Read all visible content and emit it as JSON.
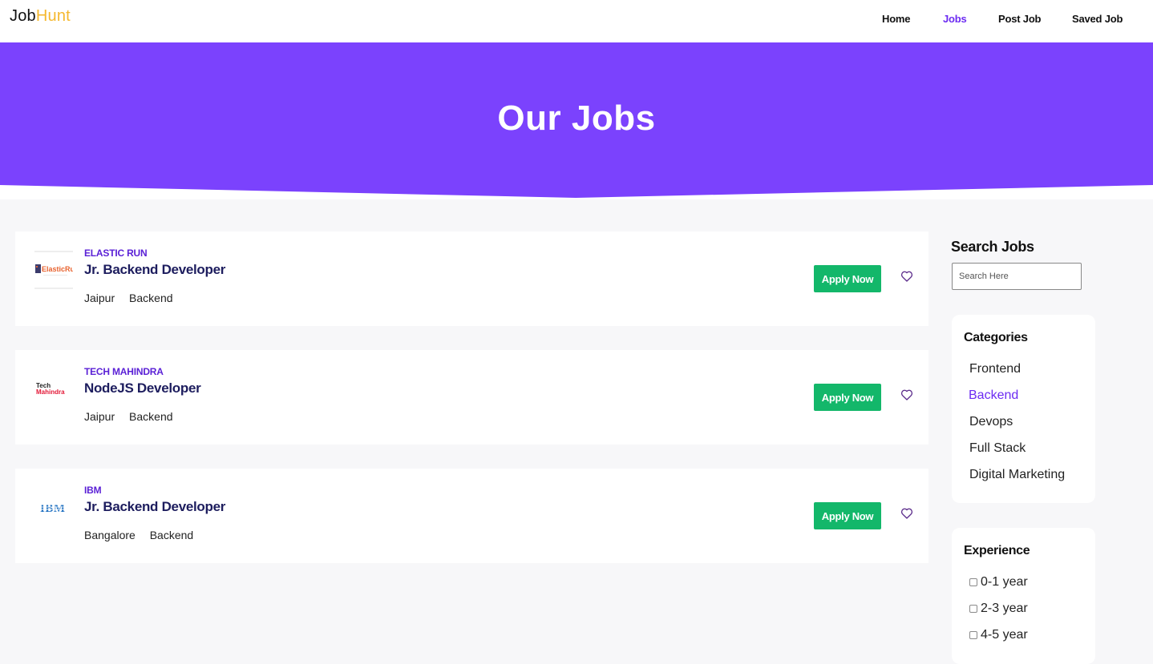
{
  "brand": {
    "logo_part1": "Job",
    "logo_part2": "Hunt"
  },
  "nav": {
    "items": [
      {
        "label": "Home",
        "active": false
      },
      {
        "label": "Jobs",
        "active": true
      },
      {
        "label": "Post Job",
        "active": false
      },
      {
        "label": "Saved Job",
        "active": false
      }
    ]
  },
  "hero": {
    "title": "Our Jobs"
  },
  "jobs": [
    {
      "company": "ELASTIC RUN",
      "title": "Jr. Backend Developer",
      "location": "Jaipur",
      "category": "Backend",
      "apply_label": "Apply Now",
      "logo_text": "ElasticRun"
    },
    {
      "company": "TECH MAHINDRA",
      "title": "NodeJS Developer",
      "location": "Jaipur",
      "category": "Backend",
      "apply_label": "Apply Now",
      "logo_text_1": "Tech",
      "logo_text_2": "Mahindra"
    },
    {
      "company": "IBM",
      "title": "Jr. Backend Developer",
      "location": "Bangalore",
      "category": "Backend",
      "apply_label": "Apply Now",
      "logo_text": "IBM"
    }
  ],
  "sidebar": {
    "search_title": "Search Jobs",
    "search_placeholder": "Search Here",
    "categories_title": "Categories",
    "categories": [
      "Frontend",
      "Backend",
      "Devops",
      "Full Stack",
      "Digital Marketing"
    ],
    "active_category": "Backend",
    "experience_title": "Experience",
    "experience": [
      "0-1 year",
      "2-3 year",
      "4-5 year"
    ]
  },
  "colors": {
    "accent": "#6c2bf2",
    "hero_bg": "#7b42fd",
    "apply_button": "#13b76a",
    "logo_highlight": "#f5b82e",
    "heart": "#6c2bf2"
  }
}
